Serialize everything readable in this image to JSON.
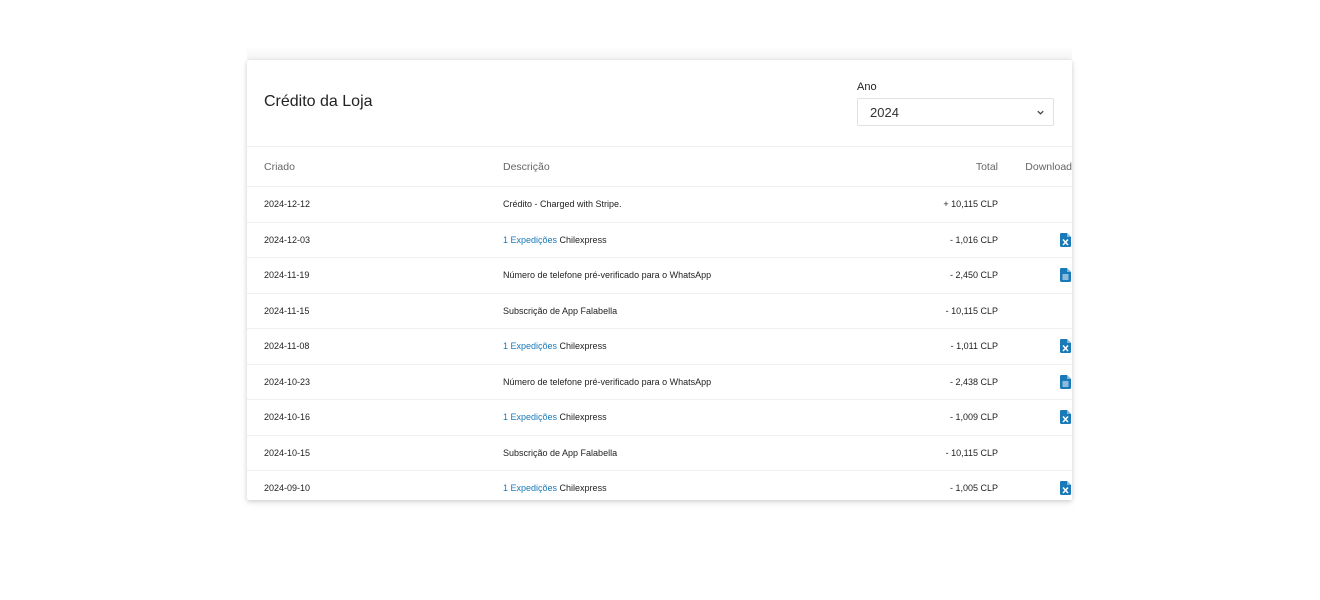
{
  "card": {
    "title": "Crédito da Loja",
    "year_label": "Ano",
    "year_value": "2024"
  },
  "table": {
    "headers": {
      "created": "Criado",
      "description": "Descrição",
      "total": "Total",
      "download": "Download"
    },
    "rows": [
      {
        "date": "2024-12-12",
        "link": "",
        "text": "Crédito - Charged with Stripe.",
        "total": "+ 10,115 CLP",
        "icon": ""
      },
      {
        "date": "2024-12-03",
        "link": "1 Expedições",
        "text": " Chilexpress",
        "total": "- 1,016 CLP",
        "icon": "excel-file-icon"
      },
      {
        "date": "2024-11-19",
        "link": "",
        "text": "Número de telefone pré-verificado para o WhatsApp",
        "total": "- 2,450 CLP",
        "icon": "document-file-icon"
      },
      {
        "date": "2024-11-15",
        "link": "",
        "text": "Subscrição de App Falabella",
        "total": "- 10,115 CLP",
        "icon": ""
      },
      {
        "date": "2024-11-08",
        "link": "1 Expedições",
        "text": " Chilexpress",
        "total": "- 1,011 CLP",
        "icon": "excel-file-icon"
      },
      {
        "date": "2024-10-23",
        "link": "",
        "text": "Número de telefone pré-verificado para o WhatsApp",
        "total": "- 2,438 CLP",
        "icon": "document-file-icon"
      },
      {
        "date": "2024-10-16",
        "link": "1 Expedições",
        "text": " Chilexpress",
        "total": "- 1,009 CLP",
        "icon": "excel-file-icon"
      },
      {
        "date": "2024-10-15",
        "link": "",
        "text": "Subscrição de App Falabella",
        "total": "- 10,115 CLP",
        "icon": ""
      },
      {
        "date": "2024-09-10",
        "link": "1 Expedições",
        "text": " Chilexpress",
        "total": "- 1,005 CLP",
        "icon": "excel-file-icon"
      }
    ]
  },
  "colors": {
    "link": "#1a7ab8",
    "icon_blue": "#1a7ab8"
  }
}
